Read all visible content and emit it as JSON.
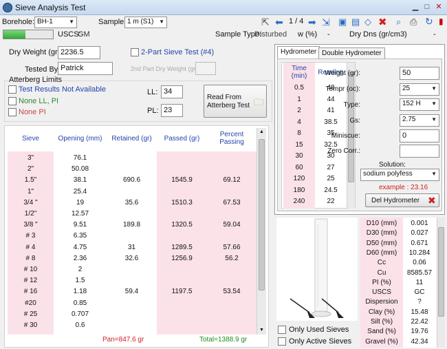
{
  "window": {
    "title": "Sieve Analysis Test"
  },
  "toolbar": {
    "borehole_label": "Borehole:",
    "borehole_value": "BH-1",
    "sample_label": "Sample:",
    "sample_value": "1 m (S1)",
    "page": "1 / 4"
  },
  "status": {
    "uscs_label": "USCS:",
    "uscs_value": "GM",
    "sample_type_label": "Sample Type:",
    "sample_type_value": "Disturbed",
    "w_label": "w (%)",
    "w_value": "-",
    "dry_dns_label": "Dry Dns (gr/cm3)",
    "dry_dns_value": "-",
    "progress": 0.45
  },
  "form": {
    "dry_weight_label": "Dry Weight (gr):",
    "dry_weight_value": "2236.5",
    "two_part_label": "2-Part Sieve Test (#4)",
    "tested_by_label": "Tested By:",
    "tested_by_value": "Patrick",
    "second_dry_label": "2nd Part Dry Weight (gr):",
    "second_dry_value": ""
  },
  "atterberg": {
    "title": "Atterberg Limits",
    "opt1": "Test Results Not Available",
    "opt2": "None LL, PI",
    "opt3": "None PI",
    "ll_label": "LL:",
    "ll_value": "34",
    "pl_label": "PL:",
    "pl_value": "23",
    "read_button": "Read From Atterberg Test"
  },
  "sieve": {
    "headers": [
      "Sieve",
      "Opening (mm)",
      "Retained (gr)",
      "Passed (gr)",
      "Percent Passing"
    ],
    "rows": [
      [
        "3\"",
        "76.1",
        "",
        "",
        ""
      ],
      [
        "2\"",
        "50.08",
        "",
        "",
        ""
      ],
      [
        "1.5\"",
        "38.1",
        "690.6",
        "1545.9",
        "69.12"
      ],
      [
        "1\"",
        "25.4",
        "",
        "",
        ""
      ],
      [
        "3/4 \"",
        "19",
        "35.6",
        "1510.3",
        "67.53"
      ],
      [
        "1/2\"",
        "12.57",
        "",
        "",
        ""
      ],
      [
        "3/8 \"",
        "9.51",
        "189.8",
        "1320.5",
        "59.04"
      ],
      [
        "# 3",
        "6.35",
        "",
        "",
        ""
      ],
      [
        "# 4",
        "4.75",
        "31",
        "1289.5",
        "57.66"
      ],
      [
        "# 8",
        "2.36",
        "32.6",
        "1256.9",
        "56.2"
      ],
      [
        "# 10",
        "2",
        "",
        "",
        ""
      ],
      [
        "# 12",
        "1.5",
        "",
        "",
        ""
      ],
      [
        "# 16",
        "1.18",
        "59.4",
        "1197.5",
        "53.54"
      ],
      [
        "#20",
        "0.85",
        "",
        "",
        ""
      ],
      [
        "# 25",
        "0.707",
        "",
        "",
        ""
      ],
      [
        "# 30",
        "0.6",
        "",
        "",
        ""
      ]
    ],
    "pan": "Pan=847.6 gr",
    "total": "Total=1388.9 gr"
  },
  "hydrometer": {
    "tab1": "Hydrometer",
    "tab2": "Double Hydrometer",
    "headers": [
      "Time (min)",
      "Reading"
    ],
    "rows": [
      [
        "0.5",
        "48"
      ],
      [
        "1",
        "44"
      ],
      [
        "2",
        "41"
      ],
      [
        "4",
        "38.5"
      ],
      [
        "8",
        "35"
      ],
      [
        "15",
        "32.5"
      ],
      [
        "30",
        "30"
      ],
      [
        "60",
        "27"
      ],
      [
        "120",
        "25"
      ],
      [
        "180",
        "24.5"
      ],
      [
        "240",
        "22"
      ]
    ],
    "weight_label": "Weight (gr):",
    "weight_value": "50",
    "tempr_label": "Tempr (oc):",
    "tempr_value": "25",
    "type_label": "Type:",
    "type_value": "152 H",
    "gs_label": "Gs:",
    "gs_value": "2.75",
    "miniscue_label": "Miniscue:",
    "miniscue_value": "0",
    "zero_label": "Zero Corr.:",
    "zero_value": "",
    "solution_label": "Solution:",
    "solution_value": "sodium polyfess",
    "example": "example : 23.16",
    "del_button": "Del Hydrometer"
  },
  "options": {
    "used_sieves": "Only Used Sieves",
    "active_sieves": "Only Active Sieves"
  },
  "results": [
    [
      "D10 (mm)",
      "0.001"
    ],
    [
      "D30 (mm)",
      "0.027"
    ],
    [
      "D50 (mm)",
      "0.671"
    ],
    [
      "D60 (mm)",
      "10.284"
    ],
    [
      "Cc",
      "0.06"
    ],
    [
      "Cu",
      "8585.57"
    ],
    [
      "PI (%)",
      "11"
    ],
    [
      "USCS",
      "GC"
    ],
    [
      "Dispersion",
      "?"
    ],
    [
      "Clay (%)",
      "15.48"
    ],
    [
      "Silt (%)",
      "22.42"
    ],
    [
      "Sand (%)",
      "19.76"
    ],
    [
      "Gravel (%)",
      "42.34"
    ]
  ]
}
